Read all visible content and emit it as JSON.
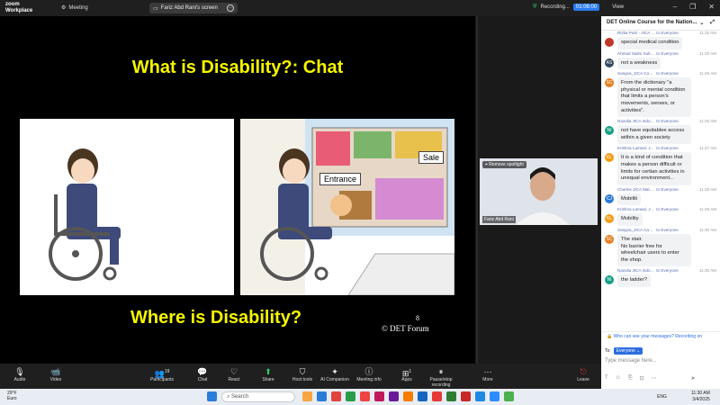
{
  "app": {
    "brand_line1": "zoom",
    "brand_line2": "Workplace",
    "meeting_label": "Meeting",
    "share_label": "Fariz Abd Rani's screen",
    "recording": "Recording...",
    "timer": "01:06:00",
    "view": "View"
  },
  "slide": {
    "title": "What is Disability?: Chat",
    "subtitle": "Where is Disability?",
    "number": "8",
    "copyright": "© DET Forum",
    "sale": "Sale",
    "entrance": "Entrance"
  },
  "video": {
    "spotlight": "Remove spotlight",
    "name": "Fariz Abd Rani"
  },
  "chat": {
    "title": "DET Online Course for the Nation...",
    "messages": [
      {
        "sender": "Rizka Putri - JICA Ind...",
        "to": "to Everyone",
        "time": "11:25 AM",
        "text": "special medical condition",
        "initials": "",
        "color": "#c0392b"
      },
      {
        "sender": "Ahmad Salim Sultany...",
        "to": "to Everyone",
        "time": "11:25 AM",
        "text": "not a weakness",
        "initials": "AS",
        "color": "#34495e"
      },
      {
        "sender": "Sangva_JICA Cambo...",
        "to": "to Everyone",
        "time": "11:26 AM",
        "text": "From the dictionary \"a physical or mental condition that limits a person's movements, senses, or activities\".",
        "initials": "SC",
        "color": "#e67e22"
      },
      {
        "sender": "Nazalia JICA Indones...",
        "to": "to Everyone",
        "time": "11:26 AM",
        "text": "not have equitablee access within a given society",
        "initials": "NI",
        "color": "#16a085"
      },
      {
        "sender": "Krishna Lamsal, JICA...",
        "to": "to Everyone",
        "time": "11:27 AM",
        "text": "It is a kind of condition that makes a person difficult or limits for certian activities in unequal environment...",
        "initials": "KL",
        "color": "#f39c12"
      },
      {
        "sender": "Charles JICA Malaysia",
        "to": "to Everyone",
        "time": "11:28 AM",
        "text": "Mobiliti",
        "initials": "CJ",
        "color": "#2b7bd8"
      },
      {
        "sender": "Krishna Lamsal, JICA...",
        "to": "to Everyone",
        "time": "11:29 AM",
        "text": "Mobility",
        "initials": "KL",
        "color": "#f39c12"
      },
      {
        "sender": "Sangva_JICA Cambo...",
        "to": "to Everyone",
        "time": "11:30 AM",
        "text": "The stair.\nNo barrier free for wheelchair users to enter the shop.",
        "initials": "SC",
        "color": "#e67e22"
      },
      {
        "sender": "Nazalia JICA Indones...",
        "to": "to Everyone",
        "time": "11:30 AM",
        "text": "the ladder?",
        "initials": "NI",
        "color": "#16a085"
      }
    ],
    "who_can_see": "Who can see your messages? Recording on",
    "to_label": "To:",
    "to_value": "Everyone",
    "placeholder": "Type message here..."
  },
  "toolbar": [
    {
      "label": "Audio",
      "icon": "mic-icon",
      "glyph": "🎙"
    },
    {
      "label": "Video",
      "icon": "video-off-icon",
      "glyph": "📹"
    },
    {
      "label": "Participants",
      "icon": "participants-icon",
      "glyph": "👥",
      "badge": "19"
    },
    {
      "label": "Chat",
      "icon": "chat-icon",
      "glyph": "💬"
    },
    {
      "label": "React",
      "icon": "react-icon",
      "glyph": "♡"
    },
    {
      "label": "Share",
      "icon": "share-icon",
      "glyph": "⬆"
    },
    {
      "label": "Host tools",
      "icon": "shield-icon",
      "glyph": "⛉"
    },
    {
      "label": "AI Companion",
      "icon": "ai-icon",
      "glyph": "✦"
    },
    {
      "label": "Meeting info",
      "icon": "info-icon",
      "glyph": "ⓘ"
    },
    {
      "label": "Apps",
      "icon": "apps-icon",
      "glyph": "⊞",
      "badge": "1"
    },
    {
      "label": "Pause/stop recording",
      "icon": "record-icon",
      "glyph": "⏸"
    },
    {
      "label": "More",
      "icon": "more-icon",
      "glyph": "⋯"
    },
    {
      "label": "Leave",
      "icon": "leave-icon",
      "glyph": "⎋"
    }
  ],
  "taskbar": {
    "weather_temp": "29°F",
    "weather_text": "Euro",
    "search": "Search",
    "lang": "ENG",
    "time": "11:30 AM",
    "date": "3/4/2025"
  }
}
